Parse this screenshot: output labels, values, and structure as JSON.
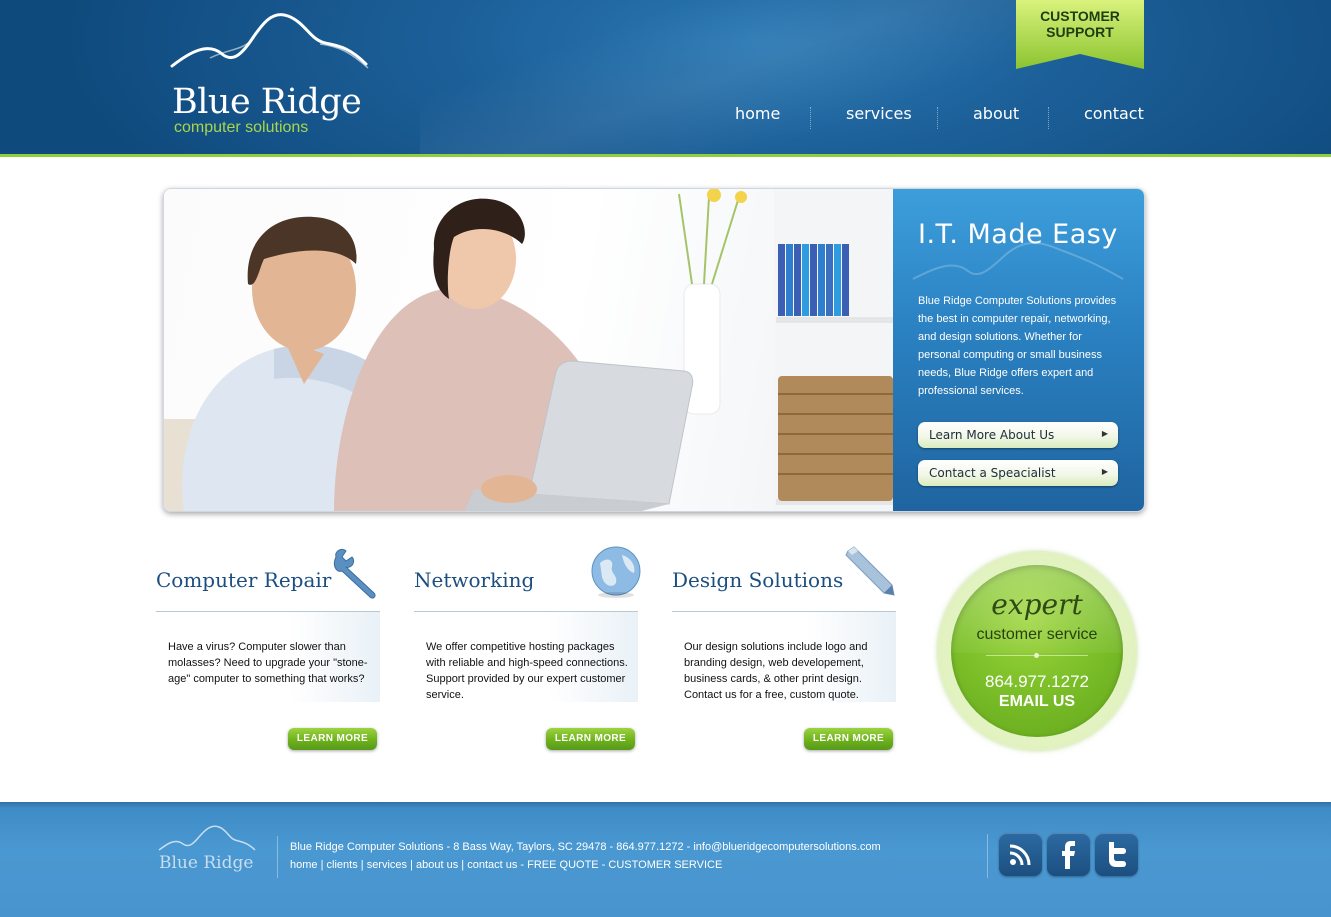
{
  "header": {
    "logo_name": "Blue Ridge",
    "logo_tagline": "computer solutions",
    "support_label": "CUSTOMER\nSUPPORT",
    "nav": [
      "home",
      "services",
      "about",
      "contact"
    ]
  },
  "hero": {
    "title": "I.T. Made Easy",
    "text": "Blue Ridge Computer Solutions provides the best in computer repair, networking, and design solutions. Whether for personal computing or small business needs, Blue Ridge offers expert and professional services.",
    "buttons": [
      "Learn More About Us",
      "Contact a Speacialist"
    ]
  },
  "features": [
    {
      "title": "Computer Repair",
      "icon": "wrench-icon",
      "text": "Have a virus? Computer slower than molasses? Need to upgrade your \"stone-age\" computer to something that works?",
      "button": "LEARN MORE"
    },
    {
      "title": "Networking",
      "icon": "globe-icon",
      "text": "We offer competitive hosting packages with reliable and high-speed connections. Support provided by our expert customer service.",
      "button": "LEARN MORE"
    },
    {
      "title": "Design Solutions",
      "icon": "pencil-icon",
      "text": "Our design solutions include logo and branding design, web developement, business cards, & other print design. Contact us for a free, custom quote.",
      "button": "LEARN MORE"
    }
  ],
  "badge": {
    "expert": "expert",
    "customer_service": "customer service",
    "phone": "864.977.1272",
    "email": "EMAIL US"
  },
  "footer": {
    "logo_name": "Blue Ridge",
    "address": "Blue Ridge Computer Solutions - 8 Bass Way, Taylors, SC 29478 - 864.977.1272 - info@blueridgecomputersolutions.com",
    "links": [
      "home",
      "clients",
      "services",
      "about us",
      "contact us - FREE QUOTE - CUSTOMER SERVICE"
    ],
    "social": [
      "rss-icon",
      "facebook-icon",
      "twitter-icon"
    ]
  },
  "colors": {
    "header_blue": "#1c5f98",
    "accent_green": "#8fcf3f",
    "panel_blue": "#2a80c0",
    "footer_blue": "#4894cf"
  }
}
